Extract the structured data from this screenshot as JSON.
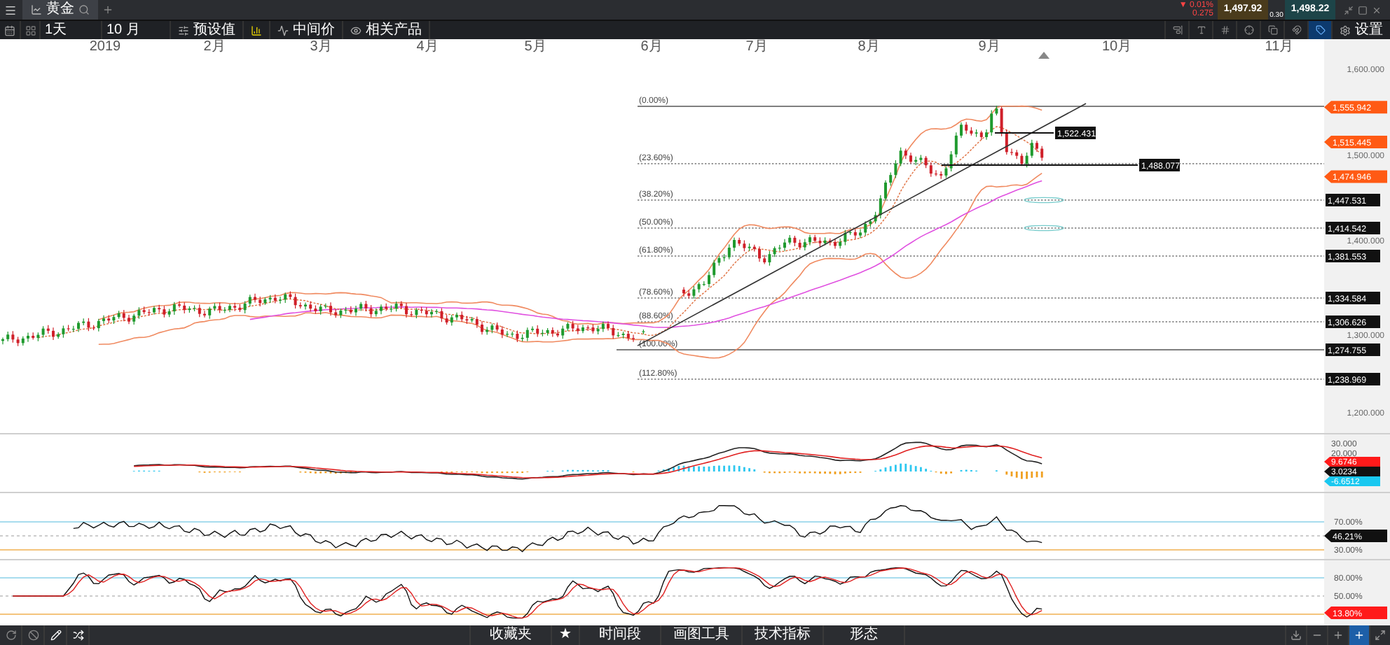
{
  "tab": {
    "title": "黄金",
    "selected": true
  },
  "quote": {
    "change_pct": "▼ 0.01%",
    "change": "0.275",
    "bid": "1,497.92",
    "spread": "0.30",
    "ask": "1,498.22"
  },
  "toolbar": {
    "period": "1天",
    "range": "10 月",
    "buttons": [
      {
        "kind": "presets",
        "label": "预设值"
      },
      {
        "kind": "bars"
      },
      {
        "kind": "mid",
        "label": "中间价"
      },
      {
        "kind": "related",
        "label": "相关产品"
      }
    ],
    "tools": [
      {
        "kind": "align",
        "selected": false
      },
      {
        "kind": "text",
        "selected": false
      },
      {
        "kind": "grid",
        "selected": false
      },
      {
        "kind": "crosshair",
        "selected": false
      },
      {
        "kind": "copy",
        "selected": false
      },
      {
        "kind": "magnet",
        "selected": false
      },
      {
        "kind": "tag",
        "selected": true
      }
    ],
    "settings": "设置"
  },
  "x_axis_labels": [
    "2019",
    "2月",
    "3月",
    "4月",
    "5月",
    "6月",
    "7月",
    "8月",
    "9月",
    "10月",
    "11月"
  ],
  "price_axis_labels": [
    "1,600.000",
    "1,500.000",
    "1,400.000",
    "1,300.000",
    "1,200.000"
  ],
  "band_tags": [
    "1,555.942",
    "1,515.445",
    "1,474.946"
  ],
  "fib_levels": [
    {
      "label": "(0.00%)",
      "kind": "solid"
    },
    {
      "label": "(23.60%)",
      "kind": "dotted"
    },
    {
      "label": "(38.20%)",
      "tag": "1,447.531",
      "kind": "dotted"
    },
    {
      "label": "(50.00%)",
      "tag": "1,414.542",
      "kind": "dotted"
    },
    {
      "label": "(61.80%)",
      "tag": "1,381.553",
      "kind": "dotted"
    },
    {
      "label": "(78.60%)",
      "tag": "1,334.584",
      "kind": "dotted"
    },
    {
      "label": "(88.60%)",
      "tag": "1,306.626",
      "kind": "dotted"
    },
    {
      "label": "(100.00%)",
      "tag": "1,274.755",
      "kind": "solid"
    },
    {
      "label": "(112.80%)",
      "tag": "1,238.969",
      "kind": "dotted"
    }
  ],
  "line_tags": [
    "1,522.431",
    "1,488.077"
  ],
  "macd": {
    "axis_labels": [
      "30.000",
      "20.000"
    ],
    "tags": [
      {
        "text": "9.6746",
        "color": "#ff1a1a"
      },
      {
        "text": "3.0234",
        "color": "#111111"
      },
      {
        "text": "-6.6512",
        "color": "#19c8f0"
      }
    ]
  },
  "rsi": {
    "axis_labels": [
      "70.00%",
      "30.00%"
    ],
    "tag": "46.21%"
  },
  "stochastic": {
    "axis_labels": [
      "80.00%",
      "50.00%"
    ],
    "tag": "13.80%"
  },
  "bottom_bar": {
    "tools": [
      {
        "kind": "refresh",
        "selected": false
      },
      {
        "kind": "block",
        "selected": false
      },
      {
        "kind": "pen",
        "selected": true
      },
      {
        "kind": "arrows",
        "selected": true
      }
    ],
    "menus": [
      "收藏夹",
      "★",
      "时间段",
      "画图工具",
      "技术指标",
      "形态"
    ],
    "zoom": [
      {
        "kind": "download",
        "selected": false
      },
      {
        "kind": "minus",
        "selected": false
      },
      {
        "kind": "plus",
        "selected": false
      },
      {
        "kind": "add",
        "selected": true
      },
      {
        "kind": "expand",
        "selected": false
      }
    ]
  }
}
